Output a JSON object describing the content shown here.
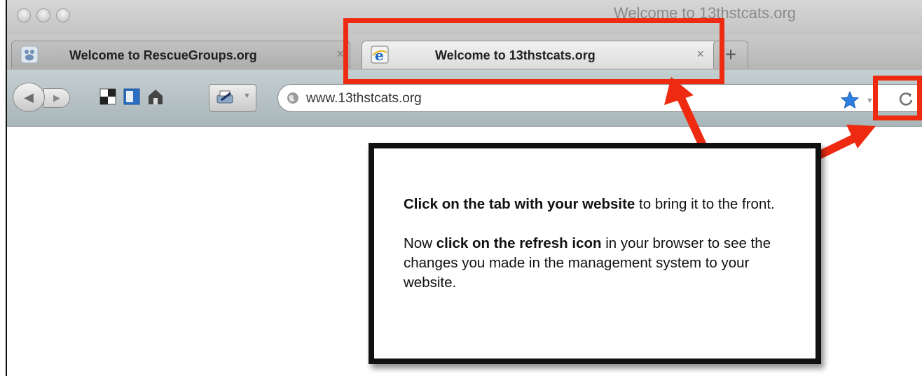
{
  "window": {
    "title": "Welcome to 13thstcats.org"
  },
  "tabs": [
    {
      "label": "Welcome to RescueGroups.org",
      "close": "×",
      "favicon": "paw-favicon-icon"
    },
    {
      "label": "Welcome to 13thstcats.org",
      "close": "×",
      "favicon": "ie-favicon-icon",
      "active": true
    }
  ],
  "new_tab": {
    "label": "+"
  },
  "toolbar": {
    "back_label": "◀",
    "forward_label": "▶",
    "address": "www.13thstcats.org",
    "icons": [
      "back-icon",
      "forward-icon",
      "panel-icon-1",
      "panel-icon-2",
      "house-icon",
      "print-icon",
      "globe-icon",
      "star-icon",
      "reload-icon"
    ]
  },
  "callout": {
    "line1_bold": "Click on the tab with your website",
    "line1_rest": " to bring it to the front.",
    "line2_pre": "Now ",
    "line2_bold": "click on the refresh icon",
    "line2_rest": " in your browser to see the changes you made in the management system to your website."
  },
  "colors": {
    "highlight": "#ee2a10",
    "star": "#2f7fe0",
    "callout_border": "#111111"
  }
}
